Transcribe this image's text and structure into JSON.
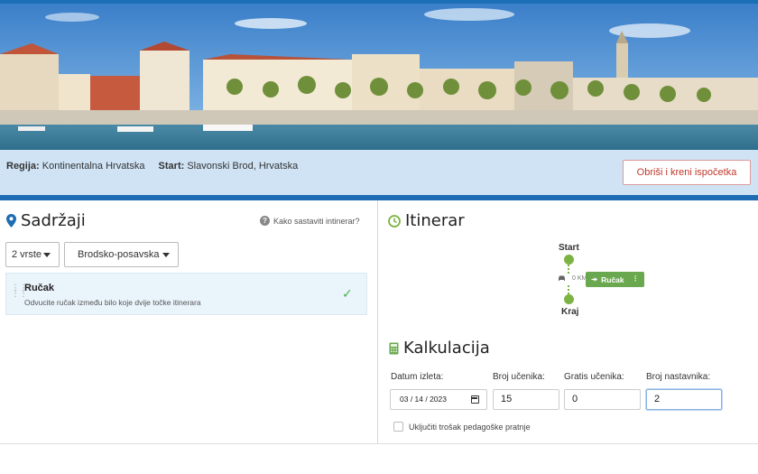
{
  "header": {
    "region_label": "Regija:",
    "region_value": "Kontinentalna Hrvatska",
    "start_label": "Start:",
    "start_value": "Slavonski Brod, Hrvatska",
    "reset_button": "Obriši i kreni ispočetka"
  },
  "content": {
    "title": "Sadržaji",
    "help_link": "Kako sastaviti intinerar?",
    "filter_type": "2 vrste",
    "filter_county": "Brodsko-posavska",
    "items": [
      {
        "title": "Ručak",
        "description": "Odvucite ručak između bilo koje dvije točke itinerara"
      }
    ]
  },
  "itinerary": {
    "title": "Itinerar",
    "start_label": "Start",
    "end_label": "Kraj",
    "distance": "0 KM",
    "stop_chip": "Ručak"
  },
  "calculation": {
    "title": "Kalkulacija",
    "date_label": "Datum izleta:",
    "date_value": "03 / 14 / 2023",
    "students_label": "Broj učenika:",
    "students_value": "15",
    "free_students_label": "Gratis učenika:",
    "free_students_value": "0",
    "teachers_label": "Broj nastavnika:",
    "teachers_value": "2",
    "checkbox_label": "Uključiti trošak pedagoške pratnje"
  },
  "icons": {
    "content": "map-pin-icon",
    "itinerary": "clock-icon",
    "calculation": "calculator-icon",
    "help": "question-circle-icon",
    "check": "checkmark-icon",
    "car": "car-icon",
    "arrow": "arrow-right-icon",
    "drag": "drag-handle-icon"
  },
  "colors": {
    "primary_blue": "#1e6db4",
    "info_bar": "#cfe3f5",
    "accent_green": "#7cb342",
    "danger_red": "#c0392b"
  }
}
